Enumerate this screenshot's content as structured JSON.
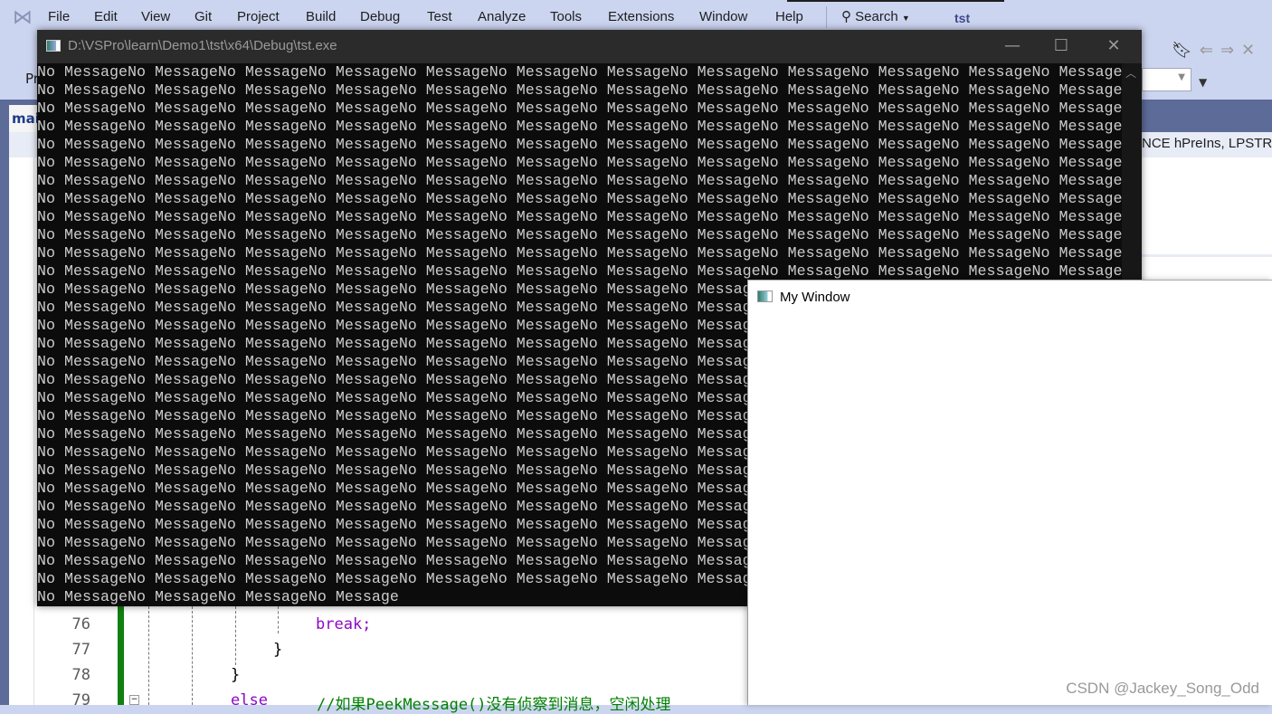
{
  "vs": {
    "menu": [
      "File",
      "Edit",
      "View",
      "Git",
      "Project",
      "Build",
      "Debug",
      "Test",
      "Analyze",
      "Tools",
      "Extensions",
      "Window",
      "Help"
    ],
    "search_label": "Search",
    "project_name": "tst",
    "nav_text": "NCE hPreIns, LPSTR",
    "tab_partial": "mai",
    "toolbar_partial": "Pr"
  },
  "editor": {
    "lines": [
      {
        "num": "76",
        "code": "break;"
      },
      {
        "num": "77",
        "code": "}"
      },
      {
        "num": "78",
        "code": "}"
      },
      {
        "num": "79",
        "keyword": "else",
        "comment": "//如果PeekMessage()没有侦察到消息，空闲处理"
      }
    ]
  },
  "console": {
    "title": "D:\\VSPro\\learn\\Demo1\\tst\\x64\\Debug\\tst.exe",
    "lines": [
      "No MessageNo MessageNo MessageNo MessageNo MessageNo MessageNo MessageNo MessageNo MessageNo MessageNo MessageNo MessageNo Message",
      "No MessageNo MessageNo MessageNo MessageNo MessageNo MessageNo MessageNo MessageNo MessageNo MessageNo MessageNo MessageNo Message",
      "No MessageNo MessageNo MessageNo MessageNo MessageNo MessageNo MessageNo MessageNo MessageNo MessageNo MessageNo MessageNo Message",
      "No MessageNo MessageNo MessageNo MessageNo MessageNo MessageNo MessageNo MessageNo MessageNo MessageNo MessageNo MessageNo Message",
      "No MessageNo MessageNo MessageNo MessageNo MessageNo MessageNo MessageNo MessageNo MessageNo MessageNo MessageNo MessageNo Message",
      "No MessageNo MessageNo MessageNo MessageNo MessageNo MessageNo MessageNo MessageNo MessageNo MessageNo MessageNo MessageNo Message",
      "No MessageNo MessageNo MessageNo MessageNo MessageNo MessageNo MessageNo MessageNo MessageNo MessageNo MessageNo MessageNo Message",
      "No MessageNo MessageNo MessageNo MessageNo MessageNo MessageNo MessageNo MessageNo MessageNo MessageNo MessageNo MessageNo Message",
      "No MessageNo MessageNo MessageNo MessageNo MessageNo MessageNo MessageNo MessageNo MessageNo MessageNo MessageNo MessageNo Message",
      "No MessageNo MessageNo MessageNo MessageNo MessageNo MessageNo MessageNo MessageNo MessageNo MessageNo MessageNo MessageNo Message",
      "No MessageNo MessageNo MessageNo MessageNo MessageNo MessageNo MessageNo MessageNo MessageNo MessageNo MessageNo MessageNo Message",
      "No MessageNo MessageNo MessageNo MessageNo MessageNo MessageNo MessageNo MessageNo MessageNo MessageNo MessageNo MessageNo Message",
      "No MessageNo MessageNo MessageNo MessageNo MessageNo MessageNo MessageNo MessageNo MessageNo MessageNo MessageNo MessageNo Message",
      "No MessageNo MessageNo MessageNo MessageNo MessageNo MessageNo MessageNo MessageNo MessageNo MessageNo MessageNo MessageNo Message",
      "No MessageNo MessageNo MessageNo MessageNo MessageNo MessageNo MessageNo MessageNo MessageNo MessageNo MessageNo MessageNo Message",
      "No MessageNo MessageNo MessageNo MessageNo MessageNo MessageNo MessageNo MessageNo MessageNo MessageNo MessageNo MessageNo Message",
      "No MessageNo MessageNo MessageNo MessageNo MessageNo MessageNo MessageNo MessageNo MessageNo MessageNo MessageNo MessageNo Message",
      "No MessageNo MessageNo MessageNo MessageNo MessageNo MessageNo MessageNo MessageNo MessageNo MessageNo MessageNo MessageNo Message",
      "No MessageNo MessageNo MessageNo MessageNo MessageNo MessageNo MessageNo MessageNo MessageNo MessageNo MessageNo MessageNo Message",
      "No MessageNo MessageNo MessageNo MessageNo MessageNo MessageNo MessageNo MessageNo MessageNo MessageNo MessageNo MessageNo Message",
      "No MessageNo MessageNo MessageNo MessageNo MessageNo MessageNo MessageNo MessageNo MessageNo MessageNo MessageNo MessageNo Message",
      "No MessageNo MessageNo MessageNo MessageNo MessageNo MessageNo MessageNo MessageNo MessageNo MessageNo MessageNo MessageNo Message",
      "No MessageNo MessageNo MessageNo MessageNo MessageNo MessageNo MessageNo MessageNo MessageNo MessageNo MessageNo MessageNo Message",
      "No MessageNo MessageNo MessageNo MessageNo MessageNo MessageNo MessageNo MessageNo MessageNo MessageNo MessageNo MessageNo Message",
      "No MessageNo MessageNo MessageNo MessageNo MessageNo MessageNo MessageNo MessageNo MessageNo MessageNo MessageNo MessageNo Message",
      "No MessageNo MessageNo MessageNo MessageNo MessageNo MessageNo MessageNo MessageNo MessageNo MessageNo MessageNo MessageNo Message",
      "No MessageNo MessageNo MessageNo MessageNo MessageNo MessageNo MessageNo MessageNo MessageNo MessageNo MessageNo MessageNo Message",
      "No MessageNo MessageNo MessageNo MessageNo MessageNo MessageNo MessageNo MessageNo MessageNo MessageNo MessageNo MessageNo Message",
      "No MessageNo MessageNo MessageNo MessageNo MessageNo MessageNo MessageNo MessageNo MessageNo MessageNo MessageNo MessageNo Message",
      "No MessageNo MessageNo MessageNo Message"
    ]
  },
  "my_window": {
    "title": "My Window"
  },
  "watermark": "CSDN @Jackey_Song_Odd",
  "colors": {
    "console_bg": "#0c0c0c",
    "console_text": "#cccccc",
    "vs_chrome": "#ccd5f0",
    "keyword": "#8f08c4",
    "comment": "#008000"
  }
}
